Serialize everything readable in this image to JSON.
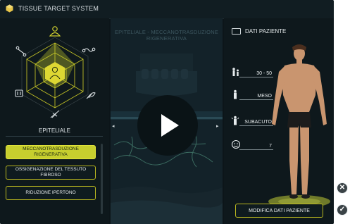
{
  "window": {
    "title": "TISSUE TARGET SYSTEM"
  },
  "left_panel": {
    "selected_tissue": "EPITELIALE",
    "tissues": [
      "epithelial",
      "tendon",
      "bone",
      "nerve",
      "muscle",
      "cartilage"
    ],
    "options": [
      {
        "label": "MECCANOTRASDUZIONE RIGENERATIVA",
        "active": true
      },
      {
        "label": "OSSIGENAZIONE DEL TESSUTO FIBROSO",
        "active": false
      },
      {
        "label": "RIDUZIONE IPERTONO",
        "active": false
      }
    ]
  },
  "video": {
    "title": "EPITELIALE - MECCANOTRASDUZIONE RIGENERATIVA",
    "play_icon": "play-icon"
  },
  "patient": {
    "header": "DATI PAZIENTE",
    "age": "30 - 50",
    "build": "MESO",
    "phase": "SUBACUTO",
    "pain": "7",
    "modify_label": "MODIFICA DATI PAZIENTE"
  },
  "side_buttons": {
    "close_symbol": "✕",
    "confirm_symbol": "✓"
  },
  "colors": {
    "accent": "#c7ce2e",
    "background": "#0c1519",
    "border": "#b9b61f"
  }
}
